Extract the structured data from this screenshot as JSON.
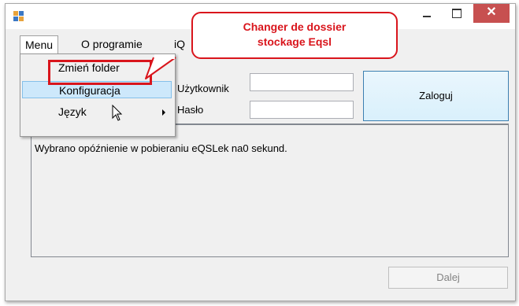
{
  "window": {
    "close_glyph": "✕"
  },
  "menubar": {
    "menu_label": "Menu",
    "about_label": "O programie",
    "iq_label": "iQ"
  },
  "dropdown": {
    "items": [
      {
        "label": "Zmień folder"
      },
      {
        "label": "Konfiguracja"
      },
      {
        "label": "Język"
      }
    ]
  },
  "callout": {
    "line1": "Changer de dossier",
    "line2": "stockage Eqsl",
    "color": "#d9151c"
  },
  "login": {
    "user_label": "Użytkownik",
    "password_label": "Hasło",
    "user_value": "",
    "password_value": "",
    "login_button": "Zaloguj"
  },
  "log": {
    "text": "Wybrano opóźnienie w pobieraniu eQSLek na0 sekund."
  },
  "footer": {
    "next_button": "Dalej"
  }
}
